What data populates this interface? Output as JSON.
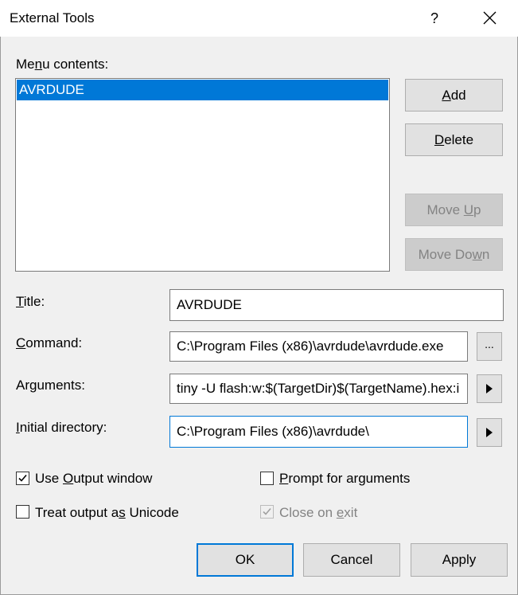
{
  "window": {
    "title": "External Tools",
    "help_glyph": "?"
  },
  "menu": {
    "label_pre": "Me",
    "label_ul": "n",
    "label_post": "u contents:",
    "items": [
      "AVRDUDE"
    ]
  },
  "side_buttons": {
    "add_ul": "A",
    "add_rest": "dd",
    "delete_ul": "D",
    "delete_rest": "elete",
    "move_up_pre": "Move ",
    "move_up_ul": "U",
    "move_up_post": "p",
    "move_down_pre": "Move Do",
    "move_down_ul": "w",
    "move_down_post": "n"
  },
  "fields": {
    "title_ul": "T",
    "title_rest": "itle:",
    "title_value": "AVRDUDE",
    "command_ul": "C",
    "command_rest": "ommand:",
    "command_value": "C:\\Program Files (x86)\\avrdude\\avrdude.exe",
    "browse_label": "...",
    "arguments_pre": "Ar",
    "arguments_ul": "g",
    "arguments_post": "uments:",
    "arguments_value": "tiny -U flash:w:$(TargetDir)$(TargetName).hex:i",
    "initdir_ul": "I",
    "initdir_rest": "nitial directory:",
    "initdir_value": "C:\\Program Files (x86)\\avrdude\\"
  },
  "options": {
    "use_output_pre": "Use ",
    "use_output_ul": "O",
    "use_output_post": "utput window",
    "use_output_checked": true,
    "prompt_ul": "P",
    "prompt_rest": "rompt for arguments",
    "prompt_checked": false,
    "unicode_pre": "Treat output a",
    "unicode_ul": "s",
    "unicode_post": " Unicode",
    "unicode_checked": false,
    "close_pre": "Close on ",
    "close_ul": "e",
    "close_post": "xit",
    "close_checked": true,
    "close_enabled": false
  },
  "footer": {
    "ok": "OK",
    "cancel": "Cancel",
    "apply": "Apply"
  },
  "colors": {
    "accent": "#0078d7",
    "disabled_text": "#838383"
  }
}
